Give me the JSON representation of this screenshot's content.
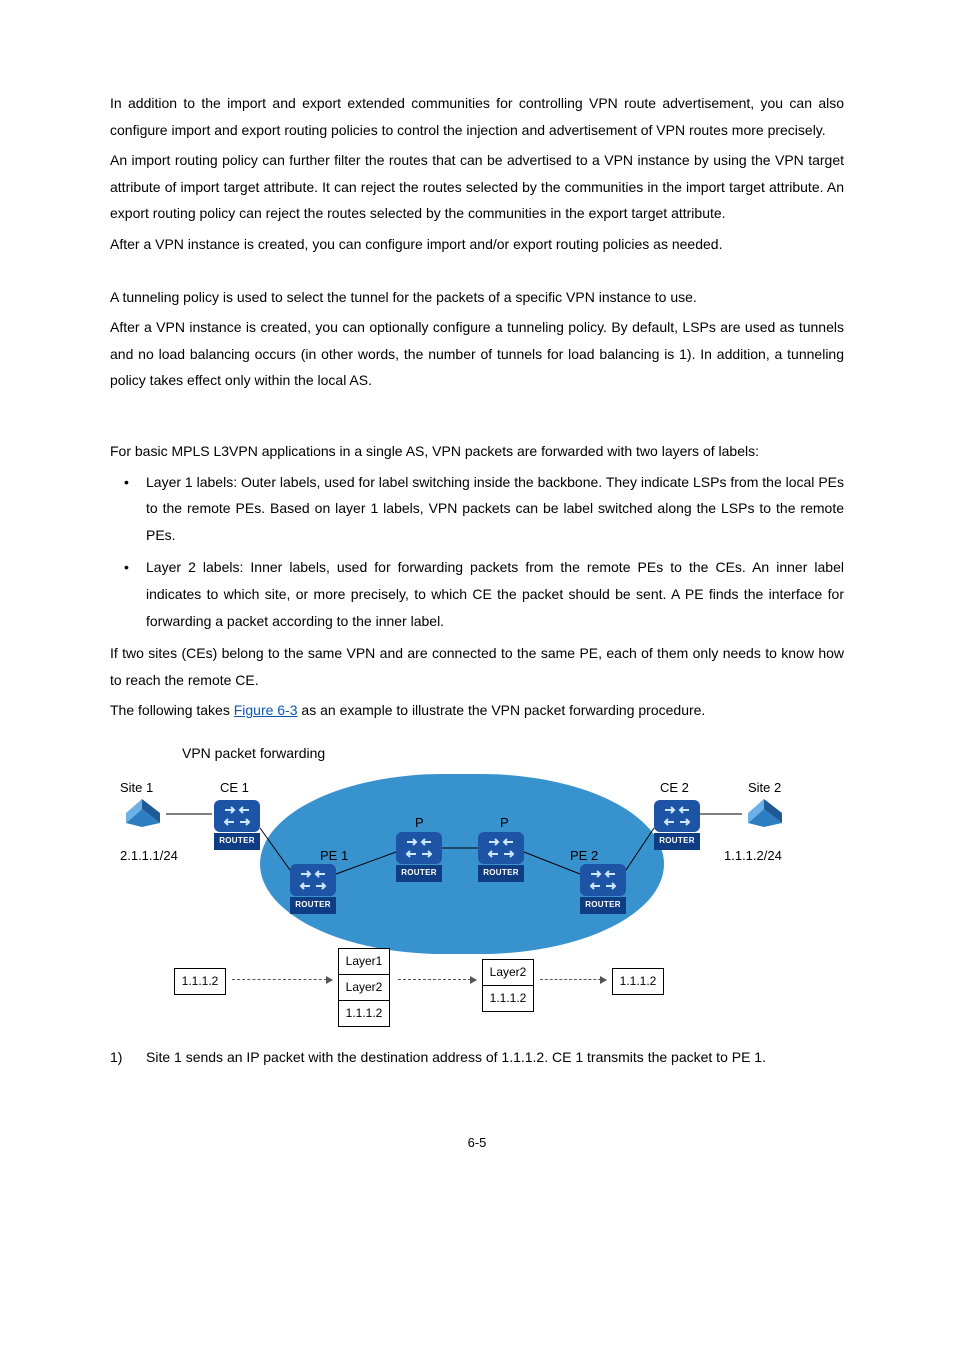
{
  "p1": "In addition to the import and export extended communities for controlling VPN route advertisement, you can also configure import and export routing policies to control the injection and advertisement of VPN routes more precisely.",
  "p2": "An import routing policy can further filter the routes that can be advertised to a VPN instance by using the VPN target attribute of import target attribute. It can reject the routes selected by the communities in the import target attribute. An export routing policy can reject the routes selected by the communities in the export target attribute.",
  "p3": "After a VPN instance is created, you can configure import and/or export routing policies as needed.",
  "p4": "A tunneling policy is used to select the tunnel for the packets of a specific VPN instance to use.",
  "p5": "After a VPN instance is created, you can optionally configure a tunneling policy. By default, LSPs are used as tunnels and no load balancing occurs (in other words, the number of tunnels for load balancing is 1). In addition, a tunneling policy takes effect only within the local AS.",
  "p6": "For basic MPLS L3VPN applications in a single AS, VPN packets are forwarded with two layers of labels:",
  "b1": "Layer 1 labels: Outer labels, used for label switching inside the backbone. They indicate LSPs from the local PEs to the remote PEs. Based on layer 1 labels, VPN packets can be label switched along the LSPs to the remote PEs.",
  "b2": "Layer 2 labels: Inner labels, used for forwarding packets from the remote PEs to the CEs. An inner label indicates to which site, or more precisely, to which CE the packet should be sent. A PE finds the interface for forwarding a packet according to the inner label.",
  "p7": "If two sites (CEs) belong to the same VPN and are connected to the same PE, each of them only needs to know how to reach the remote CE.",
  "p8a": "The following takes ",
  "p8link": "Figure 6-3",
  "p8b": " as an example to illustrate the VPN packet forwarding procedure.",
  "figcaption": "VPN packet forwarding",
  "diagram": {
    "site1": "Site 1",
    "site2": "Site 2",
    "ce1": "CE 1",
    "ce2": "CE 2",
    "pe1": "PE 1",
    "pe2": "PE 2",
    "p": "P",
    "ipLeft": "2.1.1.1/24",
    "ipRight": "1.1.1.2/24",
    "routerCap": "ROUTER",
    "layer1": "Layer1",
    "layer2": "Layer2",
    "dst": "1.1.1.2"
  },
  "n1num": "1)",
  "n1": "Site 1 sends an IP packet with the destination address of 1.1.1.2. CE 1 transmits the packet to PE 1.",
  "pageNum": "6-5"
}
